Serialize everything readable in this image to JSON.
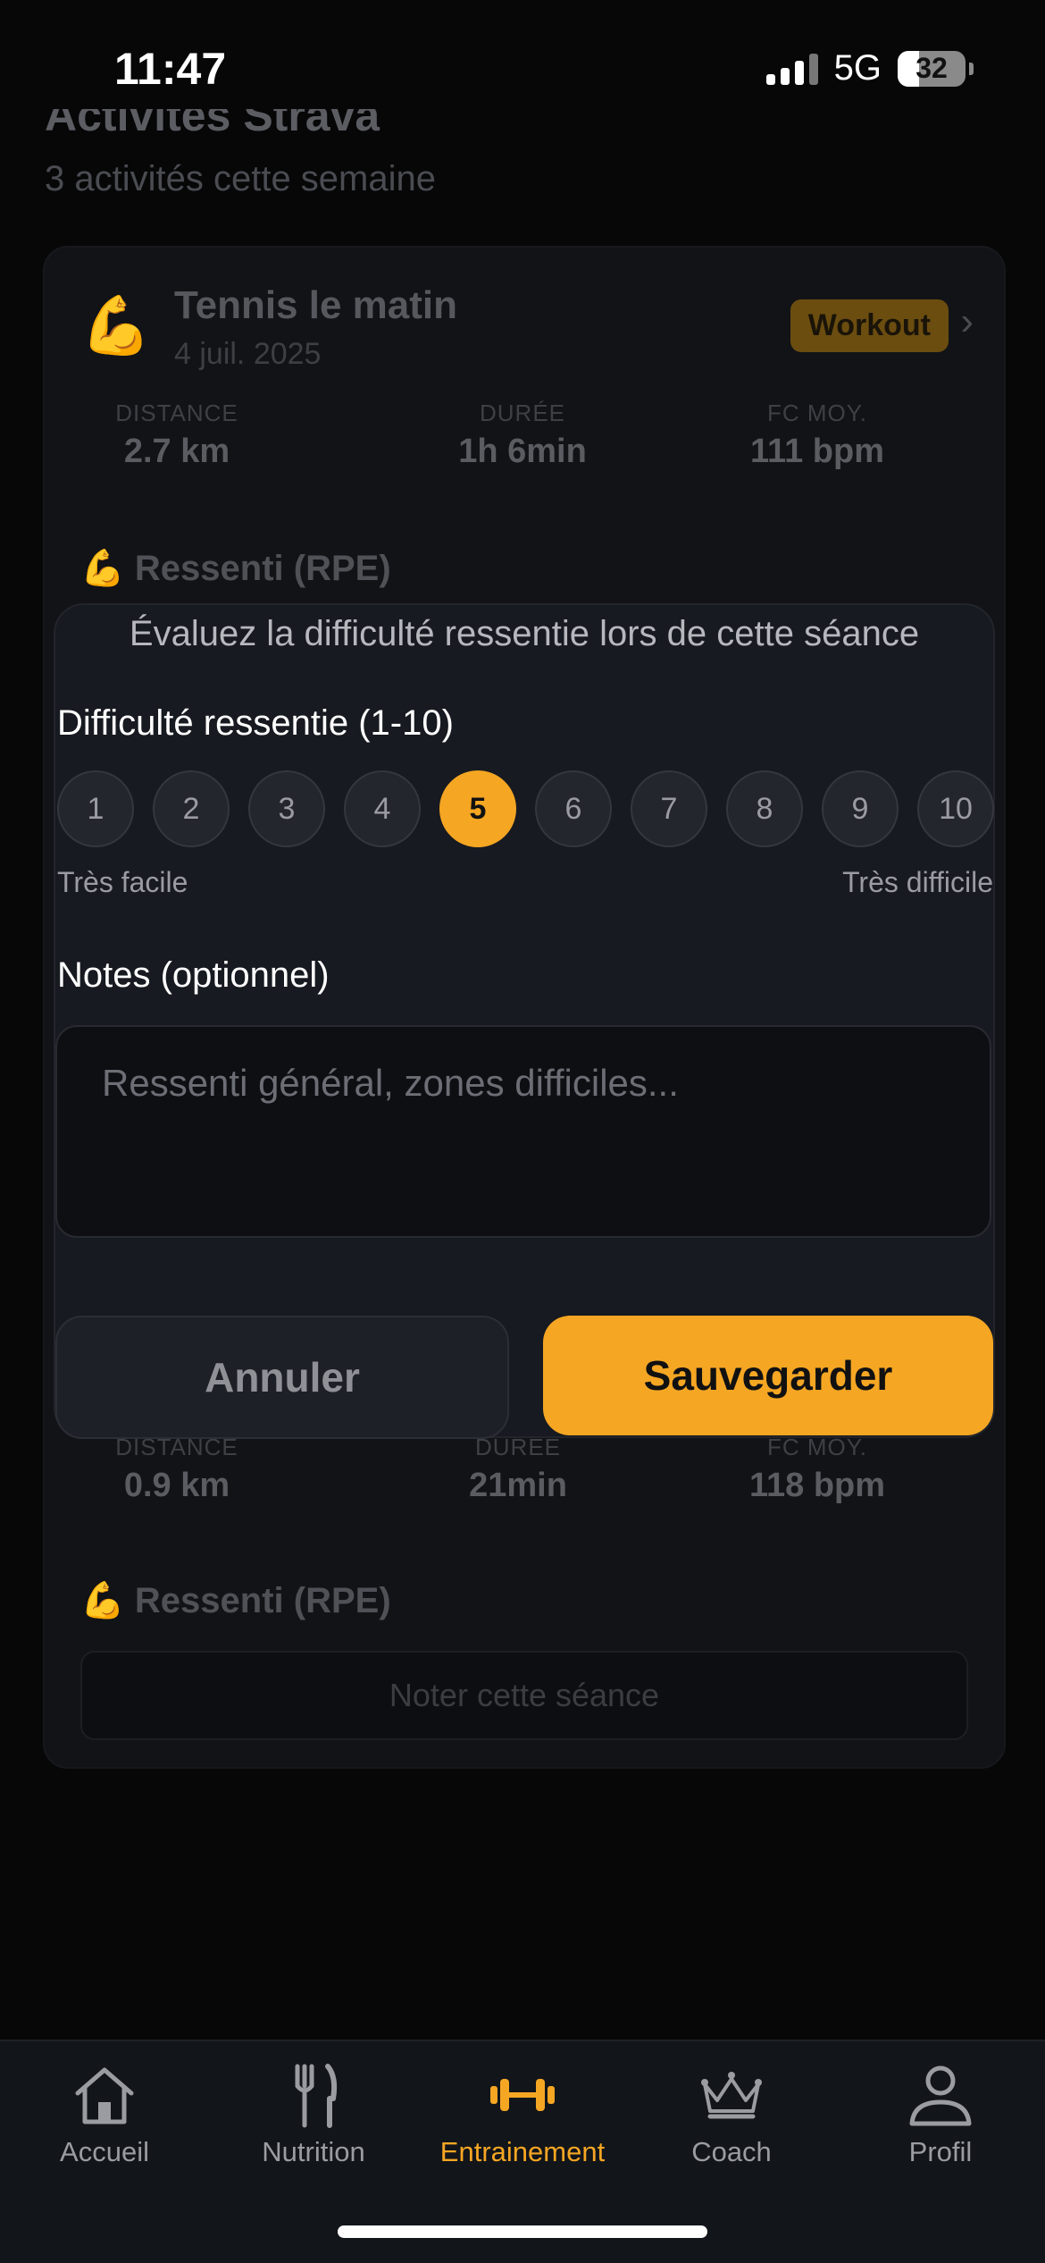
{
  "status_bar": {
    "time": "11:47",
    "network": "5G",
    "battery": "32",
    "battery_level": 0.32
  },
  "background": {
    "title": "Activités Strava",
    "subtitle": "3 activités cette semaine",
    "card1": {
      "icon": "💪",
      "name": "Tennis le matin",
      "date": "4 juil. 2025",
      "badge": "Workout",
      "stats": [
        {
          "label": "DISTANCE",
          "value": "2.7 km"
        },
        {
          "label": "DURÉE",
          "value": "1h 6min"
        },
        {
          "label": "FC MOY.",
          "value": "111 bpm"
        }
      ],
      "rpe_title": "💪 Ressenti (RPE)"
    },
    "card2": {
      "stats": [
        {
          "label": "DISTANCE",
          "value": "0.9 km"
        },
        {
          "label": "DURÉE",
          "value": "21min"
        },
        {
          "label": "FC MOY.",
          "value": "118 bpm"
        }
      ],
      "rpe_title": "💪 Ressenti (RPE)",
      "rate_button": "Noter cette séance"
    }
  },
  "modal": {
    "description": "Évaluez la difficulté ressentie lors de cette séance",
    "difficulty_label": "Difficulté ressentie (1-10)",
    "scale": [
      "1",
      "2",
      "3",
      "4",
      "5",
      "6",
      "7",
      "8",
      "9",
      "10"
    ],
    "selected": 5,
    "scale_min_label": "Très facile",
    "scale_max_label": "Très difficile",
    "notes_label": "Notes (optionnel)",
    "notes_placeholder": "Ressenti général, zones difficiles...",
    "cancel_label": "Annuler",
    "save_label": "Sauvegarder"
  },
  "tabbar": {
    "items": [
      {
        "label": "Accueil",
        "icon": "home-icon",
        "active": false
      },
      {
        "label": "Nutrition",
        "icon": "fork-knife-icon",
        "active": false
      },
      {
        "label": "Entrainement",
        "icon": "dumbbell-icon",
        "active": true
      },
      {
        "label": "Coach",
        "icon": "crown-icon",
        "active": false
      },
      {
        "label": "Profil",
        "icon": "person-icon",
        "active": false
      }
    ]
  },
  "colors": {
    "accent": "#f5a623",
    "background": "#070708",
    "modal": "#171a20"
  }
}
